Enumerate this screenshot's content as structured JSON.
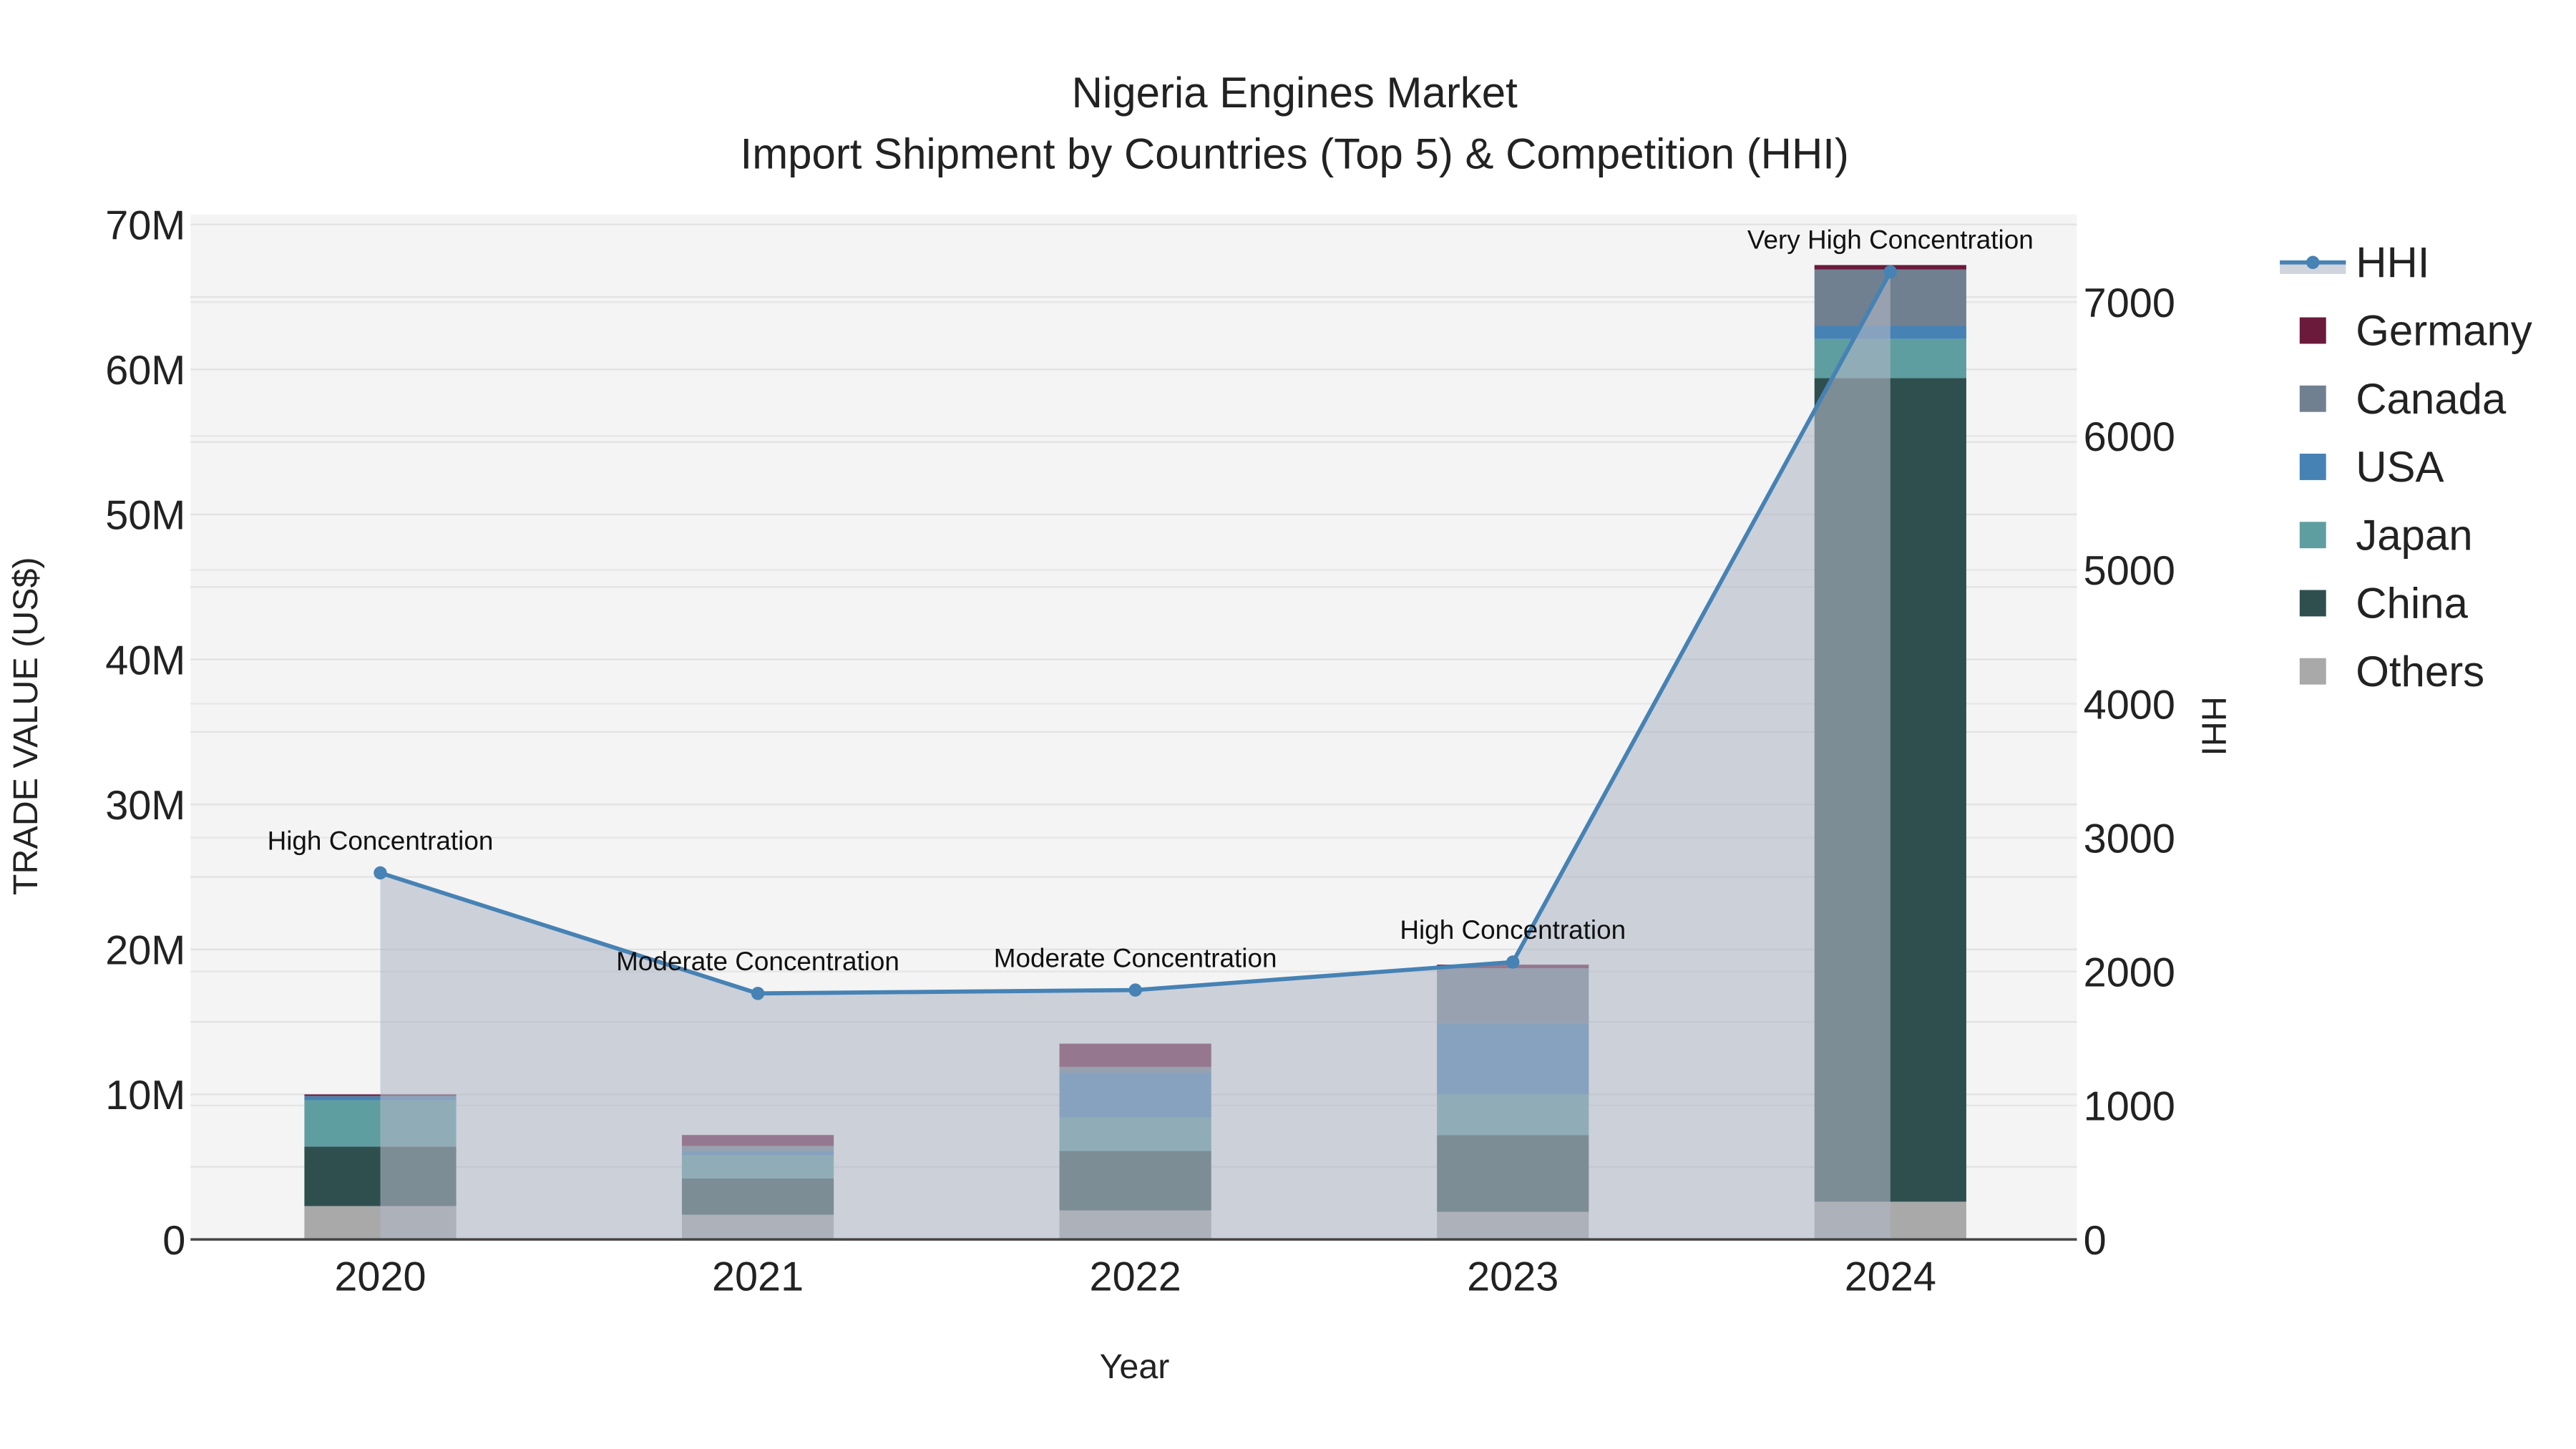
{
  "chart_data": {
    "type": "bar",
    "stacked": true,
    "title": "Nigeria  Engines Market",
    "subtitle": "Import Shipment by Countries (Top 5) & Competition (HHI)",
    "xlabel": "Year",
    "ylabel": "TRADE VALUE (US$)",
    "y2label": "HHI",
    "categories": [
      "2020",
      "2021",
      "2022",
      "2023",
      "2024"
    ],
    "ylim": [
      0,
      70000000
    ],
    "y_ticks": [
      0,
      10000000,
      20000000,
      30000000,
      40000000,
      50000000,
      60000000,
      70000000
    ],
    "y_tick_labels": [
      "0",
      "10M",
      "20M",
      "30M",
      "40M",
      "50M",
      "60M",
      "70M"
    ],
    "y2lim": [
      0,
      7000
    ],
    "y2_ticks": [
      0,
      1000,
      2000,
      3000,
      4000,
      5000,
      6000,
      7000
    ],
    "y2_tick_labels": [
      "0",
      "1000",
      "2000",
      "3000",
      "4000",
      "5000",
      "6000",
      "7000"
    ],
    "series": [
      {
        "name": "Others",
        "color": "#a9a9a9",
        "values": [
          2300000,
          1700000,
          2000000,
          1900000,
          2600000
        ]
      },
      {
        "name": "China",
        "color": "#2f4f4f",
        "values": [
          4100000,
          2500000,
          4100000,
          5300000,
          56800000
        ]
      },
      {
        "name": "Japan",
        "color": "#5f9ea0",
        "values": [
          3200000,
          1600000,
          2300000,
          2800000,
          2700000
        ]
      },
      {
        "name": "USA",
        "color": "#4682b4",
        "values": [
          250000,
          300000,
          3100000,
          4900000,
          900000
        ]
      },
      {
        "name": "Canada",
        "color": "#708090",
        "values": [
          50000,
          350000,
          400000,
          3800000,
          3900000
        ]
      },
      {
        "name": "Germany",
        "color": "#6b1a3c",
        "values": [
          100000,
          750000,
          1600000,
          250000,
          300000
        ]
      }
    ],
    "hhi": {
      "name": "HHI",
      "color": "#4682b4",
      "values": [
        2737,
        1837,
        1862,
        2071,
        7225
      ],
      "annotations": [
        "High Concentration",
        "Moderate Concentration",
        "Moderate Concentration",
        "High Concentration",
        "Very High Concentration"
      ]
    },
    "legend": {
      "placement": "right",
      "items": [
        "HHI",
        "Germany",
        "Canada",
        "USA",
        "Japan",
        "China",
        "Others"
      ]
    }
  }
}
